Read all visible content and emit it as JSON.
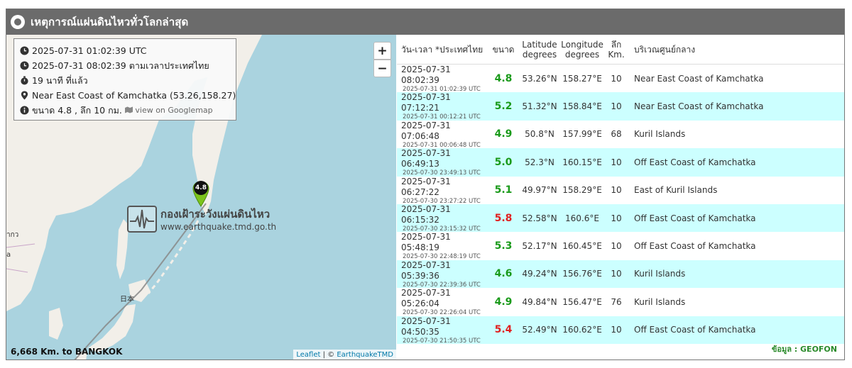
{
  "title": "เหตุการณ์แผ่นดินไหวทั่วโลกล่าสุด",
  "colors": {
    "titlebar": "#6b6b6b",
    "mag_green": "#1a9a1a",
    "mag_red": "#e02020",
    "row_alt": "#ccffff",
    "source": "#2a8a2a"
  },
  "map": {
    "zoom_in_label": "+",
    "zoom_out_label": "−",
    "popup": {
      "utc_time": "2025-07-31 01:02:39 UTC",
      "thai_time": "2025-07-31 08:02:39 ตามเวลาประเทศไทย",
      "elapsed": "19 นาที ที่แล้ว",
      "location": "Near East Coast of Kamchatka (53.26,158.27)",
      "magnitude_depth": "ขนาด 4.8 , ลึก 10 กม.",
      "googlemap_link": "view on Googlemap",
      "icons": [
        "clock-icon",
        "clock-icon",
        "timer-icon",
        "map-pin-icon",
        "info-icon",
        "map-icon"
      ]
    },
    "marker_magnitude": "4.8",
    "watermark_thai": "กองเฝ้าระวังแผ่นดินไหว",
    "watermark_url": "www.earthquake.tmd.go.th",
    "label_japan": "日本",
    "label_left1": "ากว",
    "label_left2": "a",
    "distance": "6,668 Km. to BANGKOK",
    "attribution_leaflet": "Leaflet",
    "attribution_sep": " | © ",
    "attribution_tmd": "EarthquakeTMD"
  },
  "table": {
    "headers": {
      "time": "วัน-เวลา *ประเทศไทย",
      "magnitude": "ขนาด",
      "lat_line1": "Latitude",
      "lat_line2": "degrees",
      "lon_line1": "Longitude",
      "lon_line2": "degrees",
      "depth_line1": "ลึก",
      "depth_line2": "Km.",
      "region": "บริเวณศูนย์กลาง"
    },
    "rows": [
      {
        "local": "2025-07-31 08:02:39",
        "utc": "2025-07-31 01:02:39 UTC",
        "mag": "4.8",
        "level": "green",
        "lat": "53.26°N",
        "lon": "158.27°E",
        "depth": "10",
        "region": "Near East Coast of Kamchatka"
      },
      {
        "local": "2025-07-31 07:12:21",
        "utc": "2025-07-31 00:12:21 UTC",
        "mag": "5.2",
        "level": "green",
        "lat": "51.32°N",
        "lon": "158.84°E",
        "depth": "10",
        "region": "Near East Coast of Kamchatka"
      },
      {
        "local": "2025-07-31 07:06:48",
        "utc": "2025-07-31 00:06:48 UTC",
        "mag": "4.9",
        "level": "green",
        "lat": "50.8°N",
        "lon": "157.99°E",
        "depth": "68",
        "region": "Kuril Islands"
      },
      {
        "local": "2025-07-31 06:49:13",
        "utc": "2025-07-30 23:49:13 UTC",
        "mag": "5.0",
        "level": "green",
        "lat": "52.3°N",
        "lon": "160.15°E",
        "depth": "10",
        "region": "Off East Coast of Kamchatka"
      },
      {
        "local": "2025-07-31 06:27:22",
        "utc": "2025-07-30 23:27:22 UTC",
        "mag": "5.1",
        "level": "green",
        "lat": "49.97°N",
        "lon": "158.29°E",
        "depth": "10",
        "region": "East of Kuril Islands"
      },
      {
        "local": "2025-07-31 06:15:32",
        "utc": "2025-07-30 23:15:32 UTC",
        "mag": "5.8",
        "level": "red",
        "lat": "52.58°N",
        "lon": "160.6°E",
        "depth": "10",
        "region": "Off East Coast of Kamchatka"
      },
      {
        "local": "2025-07-31 05:48:19",
        "utc": "2025-07-30 22:48:19 UTC",
        "mag": "5.3",
        "level": "green",
        "lat": "52.17°N",
        "lon": "160.45°E",
        "depth": "10",
        "region": "Off East Coast of Kamchatka"
      },
      {
        "local": "2025-07-31 05:39:36",
        "utc": "2025-07-30 22:39:36 UTC",
        "mag": "4.6",
        "level": "green",
        "lat": "49.24°N",
        "lon": "156.76°E",
        "depth": "10",
        "region": "Kuril Islands"
      },
      {
        "local": "2025-07-31 05:26:04",
        "utc": "2025-07-30 22:26:04 UTC",
        "mag": "4.9",
        "level": "green",
        "lat": "49.84°N",
        "lon": "156.47°E",
        "depth": "76",
        "region": "Kuril Islands"
      },
      {
        "local": "2025-07-31 04:50:35",
        "utc": "2025-07-30 21:50:35 UTC",
        "mag": "5.4",
        "level": "red",
        "lat": "52.49°N",
        "lon": "160.62°E",
        "depth": "10",
        "region": "Off East Coast of Kamchatka"
      }
    ]
  },
  "source_credit": "ข้อมูล : GEOFON"
}
